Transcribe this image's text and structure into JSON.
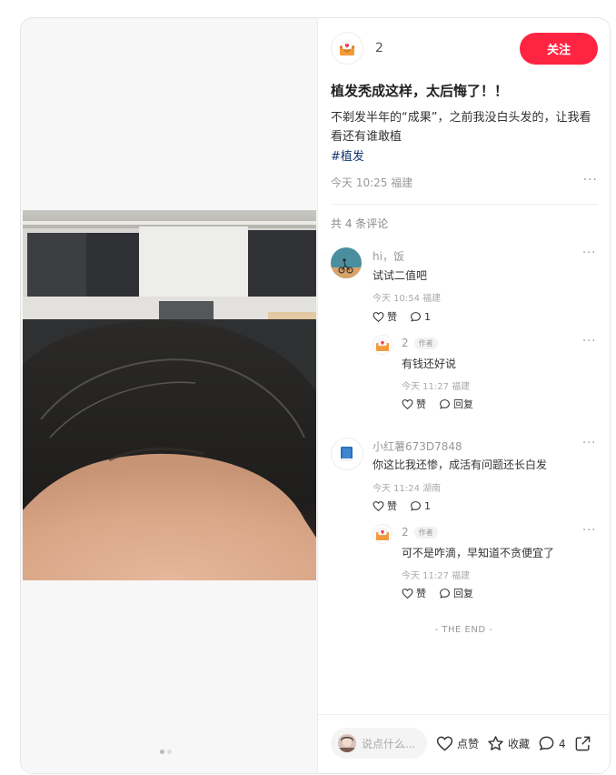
{
  "author": {
    "name": "2",
    "follow_label": "关注"
  },
  "note": {
    "title": "植发秃成这样，太后悔了！！",
    "description": "不剃发半年的“成果”，之前我没白头发的，让我看看还有谁敢植",
    "tag": "#植发",
    "meta": "今天 10:25 福建",
    "more": "···"
  },
  "comments_header": "共 4 条评论",
  "comments": [
    {
      "name": "hi，饭",
      "text": "试试二值吧",
      "meta": "今天 10:54 福建",
      "like_label": "赞",
      "reply_count": "1",
      "reply": {
        "name": "2",
        "badge": "作者",
        "text": "有钱还好说",
        "meta": "今天 11:27 福建",
        "like_label": "赞",
        "reply_label": "回复"
      }
    },
    {
      "name": "小红薯673D7848",
      "text": "你这比我还惨，成活有问题还长白发",
      "meta": "今天 11:24 湖南",
      "like_label": "赞",
      "reply_count": "1",
      "reply": {
        "name": "2",
        "badge": "作者",
        "text": "可不是咋滴，早知道不贪便宜了",
        "meta": "今天 11:27 福建",
        "like_label": "赞",
        "reply_label": "回复"
      }
    }
  ],
  "end_text": "- THE END -",
  "bottom_bar": {
    "input_placeholder": "说点什么...",
    "like_label": "点赞",
    "collect_label": "收藏",
    "comment_count": "4"
  },
  "colors": {
    "accent": "#ff2442",
    "tag": "#13386c"
  },
  "icons": [
    "mail-heart-icon",
    "heart-icon",
    "comment-icon",
    "star-icon",
    "share-icon",
    "more-icon"
  ]
}
